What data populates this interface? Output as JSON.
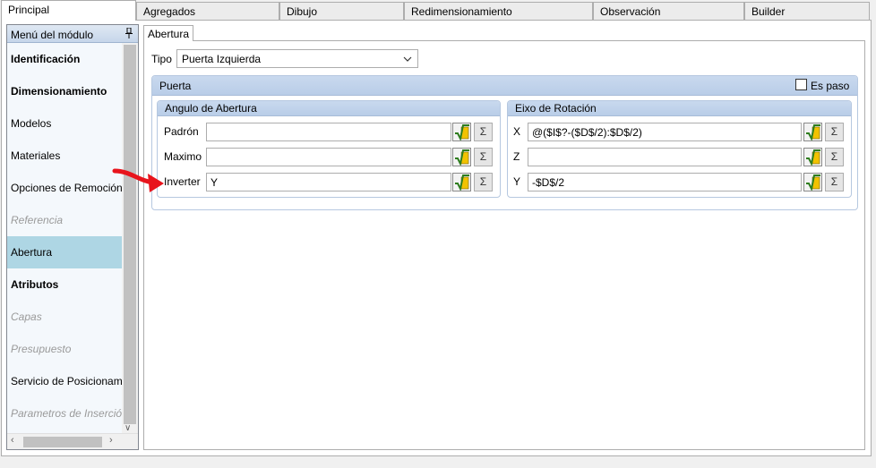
{
  "top_tabs": {
    "principal": "Principal",
    "agregados": "Agregados",
    "dibujo": "Dibujo",
    "redimensionamiento": "Redimensionamiento",
    "observacion": "Observación",
    "builder": "Builder"
  },
  "sidebar": {
    "header": "Menú del módulo",
    "items": [
      {
        "label": "Identificación"
      },
      {
        "label": "Dimensionamiento"
      },
      {
        "label": "Modelos"
      },
      {
        "label": "Materiales"
      },
      {
        "label": "Opciones de Remoción"
      },
      {
        "label": "Referencia"
      },
      {
        "label": "Abertura"
      },
      {
        "label": "Atributos"
      },
      {
        "label": "Capas"
      },
      {
        "label": "Presupuesto"
      },
      {
        "label": "Servicio de Posicionamiento"
      },
      {
        "label": "Parametros de Inserción"
      }
    ],
    "scroll_left": "‹",
    "scroll_right": "›",
    "scroll_down": "∨"
  },
  "sub_tab": "Abertura",
  "tipo": {
    "label": "Tipo",
    "value": "Puerta Izquierda"
  },
  "puerta": {
    "title": "Puerta",
    "es_paso_label": "Es paso",
    "es_paso_checked": false
  },
  "angulo": {
    "title": "Angulo de Abertura",
    "fields": [
      {
        "label": "Padrón",
        "value": ""
      },
      {
        "label": "Maximo",
        "value": ""
      },
      {
        "label": "Inverter",
        "value": "Y"
      }
    ]
  },
  "eixo": {
    "title": "Eixo de Rotación",
    "fields": [
      {
        "label": "X",
        "value": "@($I$?-($D$/2):$D$/2)"
      },
      {
        "label": "Z",
        "value": ""
      },
      {
        "label": "Y",
        "value": "-$D$/2"
      }
    ]
  },
  "sum_symbol": "Σ",
  "colors": {
    "selected_item": "#aed6e4",
    "group_header": "#c9d9ee",
    "arrow": "#e8141c",
    "fx_green": "#2e7d1e",
    "fx_yellow": "#f2c200"
  },
  "icons": [
    "pin-icon",
    "chevron-down-icon",
    "formula-icon",
    "sigma-icon",
    "red-arrow"
  ]
}
